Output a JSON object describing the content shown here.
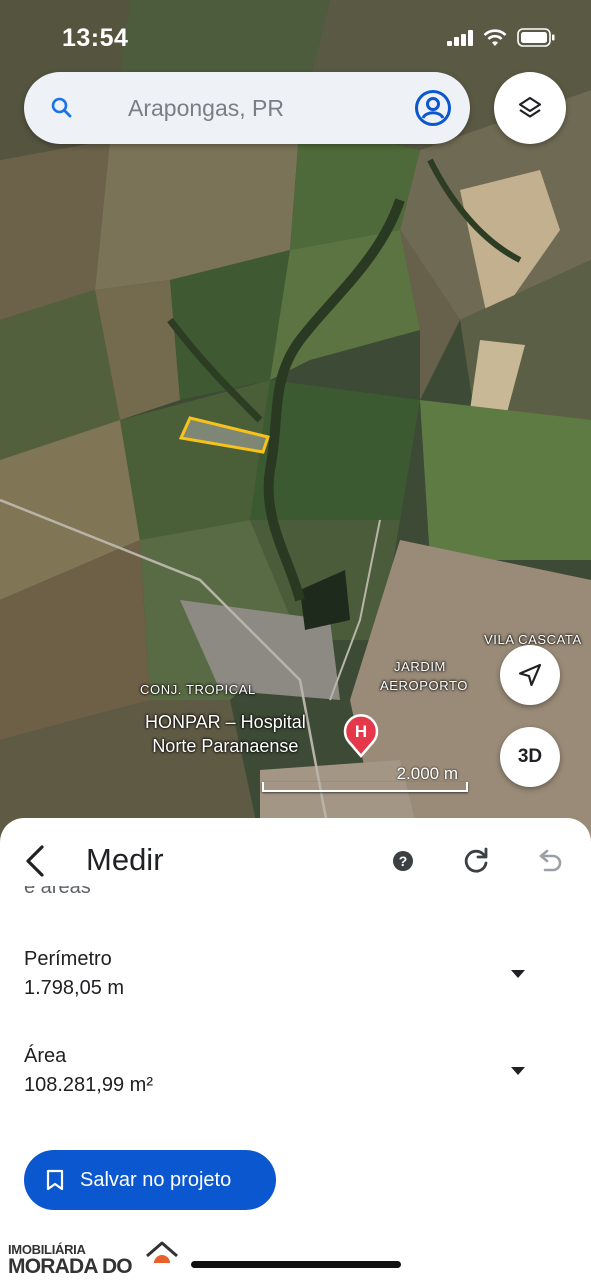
{
  "status": {
    "time": "13:54"
  },
  "search": {
    "placeholder": "Arapongas, PR"
  },
  "map": {
    "labels": {
      "vila_cascata": "VILA CASCATA",
      "jardim_aeroporto_1": "JARDIM",
      "jardim_aeroporto_2": "AEROPORTO",
      "conj_tropical": "CONJ. TROPICAL"
    },
    "poi": {
      "line1": "HONPAR – Hospital",
      "line2": "Norte Paranaense",
      "pin_letter": "H"
    },
    "scale": "2.000 m",
    "button_3d": "3D"
  },
  "sheet": {
    "title": "Medir",
    "cut_text": "e áreas",
    "perimeter": {
      "label": "Perímetro",
      "value": "1.798,05 m"
    },
    "area": {
      "label": "Área",
      "value": "108.281,99 m²"
    },
    "save_label": "Salvar no projeto"
  },
  "brand": {
    "line1": "IMOBILIÁRIA",
    "line2": "MORADA DO SOL"
  },
  "colors": {
    "accent": "#0b57d0",
    "measure_outline": "#f7c21a",
    "pin": "#e5394b"
  },
  "icons": [
    "search-icon",
    "account-icon",
    "layers-icon",
    "navigation-arrow-icon",
    "back-arrow-icon",
    "help-icon",
    "redo-icon",
    "undo-icon",
    "chevron-down-icon",
    "bookmark-icon"
  ]
}
